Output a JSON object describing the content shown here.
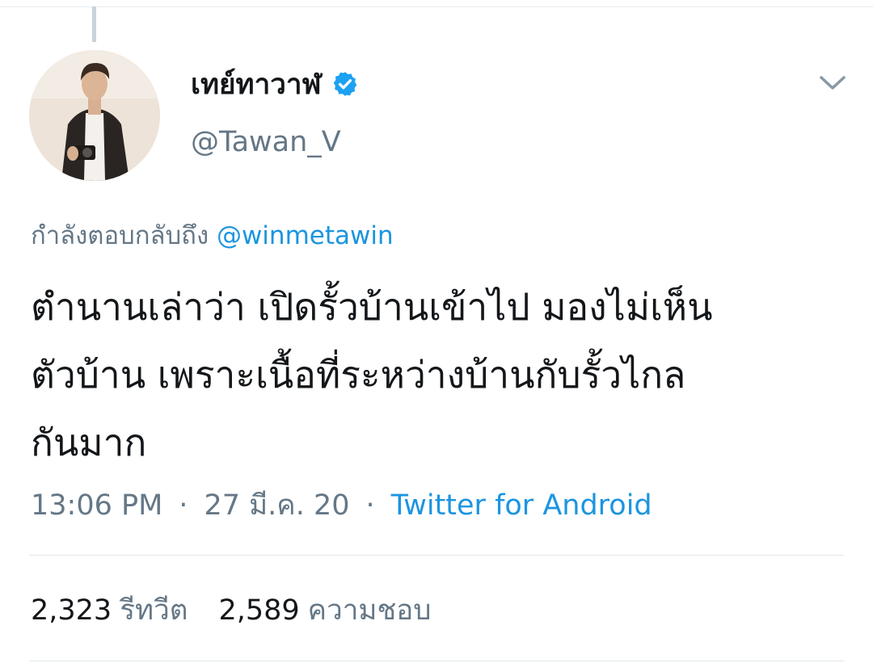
{
  "tweet": {
    "display_name": "เทย์ทาวาฬ",
    "handle": "@Tawan_V",
    "verified": true,
    "reply_prefix": "กำลังตอบกลับถึง",
    "reply_mention": "@winmetawin",
    "text_lines": [
      "ตำนานเล่าว่า เปิดรั้วบ้านเข้าไป มองไม่เห็น",
      "ตัวบ้าน เพราะเนื้อที่ระหว่างบ้านกับรั้วไกล",
      "กันมาก"
    ],
    "time": "13:06 PM",
    "date": "27 มี.ค. 20",
    "separator": "·",
    "source": "Twitter for Android"
  },
  "stats": {
    "retweets_count": "2,323",
    "retweets_label": "รีทวีต",
    "likes_count": "2,589",
    "likes_label": "ความชอบ"
  },
  "icons": {
    "verified": "verified-badge-icon",
    "menu": "chevron-down-icon"
  },
  "colors": {
    "accent": "#1b95e0",
    "secondary_text": "#657786",
    "primary_text": "#14171a",
    "verified": "#1da1f2"
  }
}
